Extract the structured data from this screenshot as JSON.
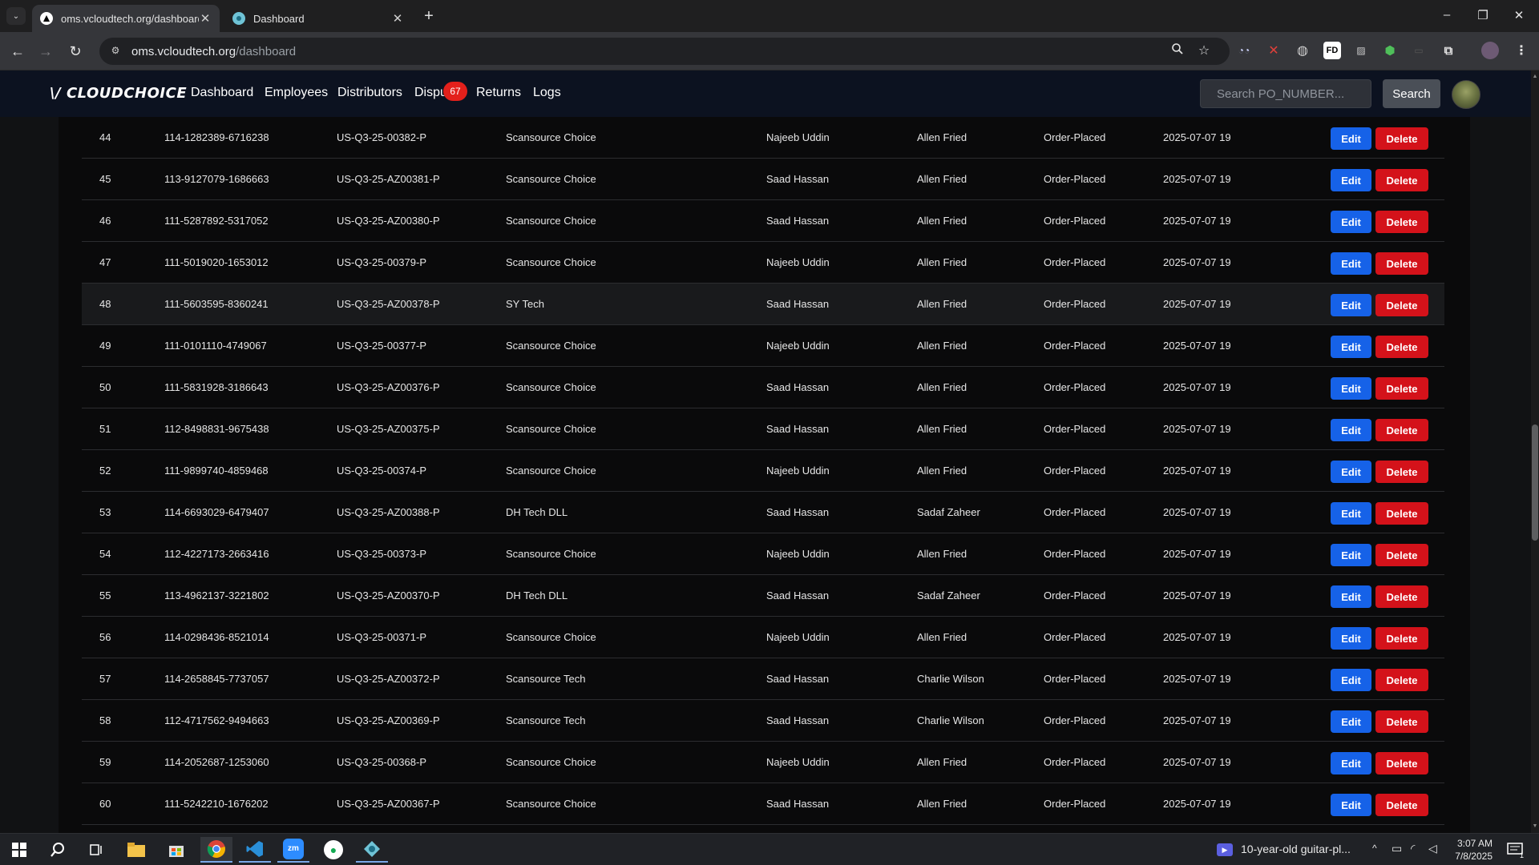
{
  "browser": {
    "tabs": [
      {
        "title": "oms.vcloudtech.org/dashboard",
        "active": true
      },
      {
        "title": "Dashboard",
        "active": false
      }
    ],
    "url_host": "oms.vcloudtech.org",
    "url_path": "/dashboard",
    "window_controls": {
      "minimize": "–",
      "restore": "❐",
      "close": "✕"
    }
  },
  "app": {
    "logo": "CLOUDCHOICE",
    "logo_mark": "\\/",
    "nav": {
      "dashboard": "Dashboard",
      "employees": "Employees",
      "distributors": "Distributors",
      "disputes": "Dispu",
      "returns": "Returns",
      "logs": "Logs"
    },
    "disputes_badge": "67",
    "search_placeholder": "Search PO_NUMBER...",
    "search_button": "Search"
  },
  "table": {
    "edit_label": "Edit",
    "delete_label": "Delete",
    "rows": [
      {
        "id": "44",
        "order": "114-1282389-6716238",
        "po": "US-Q3-25-00382-P",
        "distributor": "Scansource Choice",
        "created_by": "Najeeb Uddin",
        "assignee": "Allen Fried",
        "status": "Order-Placed",
        "date": "2025-07-07 19"
      },
      {
        "id": "45",
        "order": "113-9127079-1686663",
        "po": "US-Q3-25-AZ00381-P",
        "distributor": "Scansource Choice",
        "created_by": "Saad Hassan",
        "assignee": "Allen Fried",
        "status": "Order-Placed",
        "date": "2025-07-07 19"
      },
      {
        "id": "46",
        "order": "111-5287892-5317052",
        "po": "US-Q3-25-AZ00380-P",
        "distributor": "Scansource Choice",
        "created_by": "Saad Hassan",
        "assignee": "Allen Fried",
        "status": "Order-Placed",
        "date": "2025-07-07 19"
      },
      {
        "id": "47",
        "order": "111-5019020-1653012",
        "po": "US-Q3-25-00379-P",
        "distributor": "Scansource Choice",
        "created_by": "Najeeb Uddin",
        "assignee": "Allen Fried",
        "status": "Order-Placed",
        "date": "2025-07-07 19"
      },
      {
        "id": "48",
        "order": "111-5603595-8360241",
        "po": "US-Q3-25-AZ00378-P",
        "distributor": "SY Tech",
        "created_by": "Saad Hassan",
        "assignee": "Allen Fried",
        "status": "Order-Placed",
        "date": "2025-07-07 19"
      },
      {
        "id": "49",
        "order": "111-0101110-4749067",
        "po": "US-Q3-25-00377-P",
        "distributor": "Scansource Choice",
        "created_by": "Najeeb Uddin",
        "assignee": "Allen Fried",
        "status": "Order-Placed",
        "date": "2025-07-07 19"
      },
      {
        "id": "50",
        "order": "111-5831928-3186643",
        "po": "US-Q3-25-AZ00376-P",
        "distributor": "Scansource Choice",
        "created_by": "Saad Hassan",
        "assignee": "Allen Fried",
        "status": "Order-Placed",
        "date": "2025-07-07 19"
      },
      {
        "id": "51",
        "order": "112-8498831-9675438",
        "po": "US-Q3-25-AZ00375-P",
        "distributor": "Scansource Choice",
        "created_by": "Saad Hassan",
        "assignee": "Allen Fried",
        "status": "Order-Placed",
        "date": "2025-07-07 19"
      },
      {
        "id": "52",
        "order": "111-9899740-4859468",
        "po": "US-Q3-25-00374-P",
        "distributor": "Scansource Choice",
        "created_by": "Najeeb Uddin",
        "assignee": "Allen Fried",
        "status": "Order-Placed",
        "date": "2025-07-07 19"
      },
      {
        "id": "53",
        "order": "114-6693029-6479407",
        "po": "US-Q3-25-AZ00388-P",
        "distributor": "DH Tech DLL",
        "created_by": "Saad Hassan",
        "assignee": "Sadaf Zaheer",
        "status": "Order-Placed",
        "date": "2025-07-07 19"
      },
      {
        "id": "54",
        "order": "112-4227173-2663416",
        "po": "US-Q3-25-00373-P",
        "distributor": "Scansource Choice",
        "created_by": "Najeeb Uddin",
        "assignee": "Allen Fried",
        "status": "Order-Placed",
        "date": "2025-07-07 19"
      },
      {
        "id": "55",
        "order": "113-4962137-3221802",
        "po": "US-Q3-25-AZ00370-P",
        "distributor": "DH Tech DLL",
        "created_by": "Saad Hassan",
        "assignee": "Sadaf Zaheer",
        "status": "Order-Placed",
        "date": "2025-07-07 19"
      },
      {
        "id": "56",
        "order": "114-0298436-8521014",
        "po": "US-Q3-25-00371-P",
        "distributor": "Scansource Choice",
        "created_by": "Najeeb Uddin",
        "assignee": "Allen Fried",
        "status": "Order-Placed",
        "date": "2025-07-07 19"
      },
      {
        "id": "57",
        "order": "114-2658845-7737057",
        "po": "US-Q3-25-AZ00372-P",
        "distributor": "Scansource Tech",
        "created_by": "Saad Hassan",
        "assignee": "Charlie Wilson",
        "status": "Order-Placed",
        "date": "2025-07-07 19"
      },
      {
        "id": "58",
        "order": "112-4717562-9494663",
        "po": "US-Q3-25-AZ00369-P",
        "distributor": "Scansource Tech",
        "created_by": "Saad Hassan",
        "assignee": "Charlie Wilson",
        "status": "Order-Placed",
        "date": "2025-07-07 19"
      },
      {
        "id": "59",
        "order": "114-2052687-1253060",
        "po": "US-Q3-25-00368-P",
        "distributor": "Scansource Choice",
        "created_by": "Najeeb Uddin",
        "assignee": "Allen Fried",
        "status": "Order-Placed",
        "date": "2025-07-07 19"
      },
      {
        "id": "60",
        "order": "111-5242210-1676202",
        "po": "US-Q3-25-AZ00367-P",
        "distributor": "Scansource Choice",
        "created_by": "Saad Hassan",
        "assignee": "Allen Fried",
        "status": "Order-Placed",
        "date": "2025-07-07 19"
      }
    ]
  },
  "taskbar": {
    "media_title": "10-year-old guitar-pl...",
    "time": "3:07 AM",
    "date": "7/8/2025",
    "notification_count": "1"
  },
  "colors": {
    "edit_button": "#1662e8",
    "delete_button": "#d4121a",
    "badge": "#e3201b",
    "app_header": "#0c1220"
  }
}
